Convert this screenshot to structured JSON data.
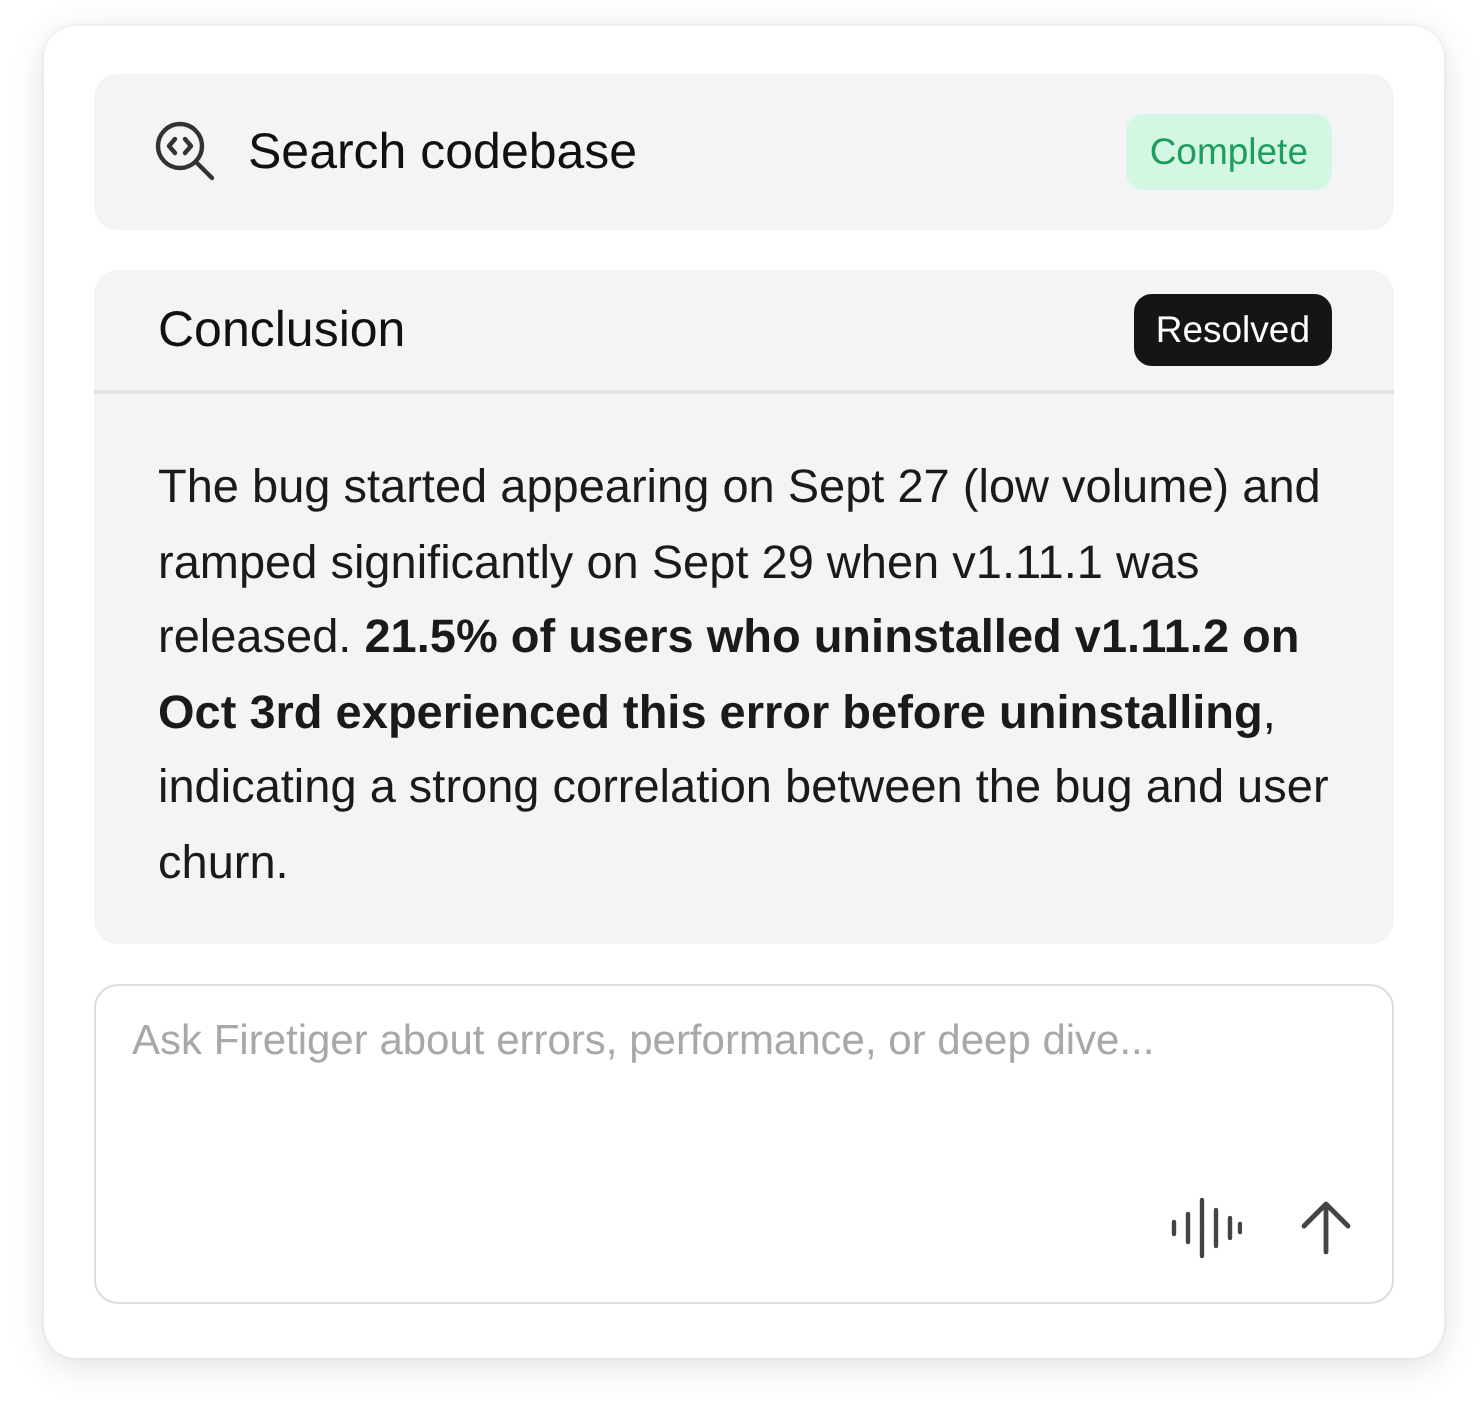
{
  "tool_step": {
    "title": "Search codebase",
    "badge": {
      "label": "Complete",
      "kind": "success"
    }
  },
  "conclusion": {
    "title": "Conclusion",
    "badge": {
      "label": "Resolved",
      "kind": "dark"
    },
    "text": "The bug started appearing on Sept 27 (low volume) and ramped significantly on Sept 29 when v1.11.1 was released. **21.5% of users who uninstalled v1.11.2 on Oct 3rd experienced this error before uninstalling**, indicating a strong correlation between the bug and user churn."
  },
  "composer": {
    "placeholder": "Ask Firetiger about errors, performance, or deep dive..."
  }
}
